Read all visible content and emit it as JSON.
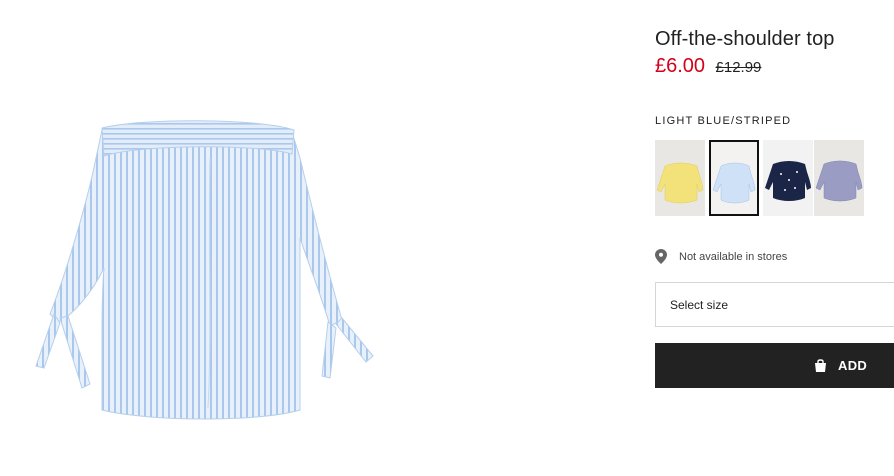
{
  "product": {
    "title": "Off-the-shoulder top",
    "price_now": "£6.00",
    "price_was": "£12.99",
    "image_icon": "blue-striped-off-shoulder-top-image"
  },
  "color": {
    "label": "LIGHT BLUE/STRIPED",
    "swatches": [
      {
        "name": "yellow",
        "color": "#f3e27a",
        "selected": false
      },
      {
        "name": "light-blue-striped",
        "color": "#bcd6f2",
        "selected": true
      },
      {
        "name": "dark-blue-dotted",
        "color": "#1b2547",
        "selected": false
      },
      {
        "name": "lavender",
        "color": "#9a9cc4",
        "selected": false
      }
    ]
  },
  "availability": {
    "icon": "location-pin-icon",
    "text": "Not available in stores"
  },
  "size": {
    "placeholder": "Select size"
  },
  "cart": {
    "icon": "shopping-bag-icon",
    "label": "ADD"
  },
  "colors": {
    "sale": "#d6001c",
    "button_bg": "#222222",
    "stripe_blue": "#9fc2ea"
  }
}
